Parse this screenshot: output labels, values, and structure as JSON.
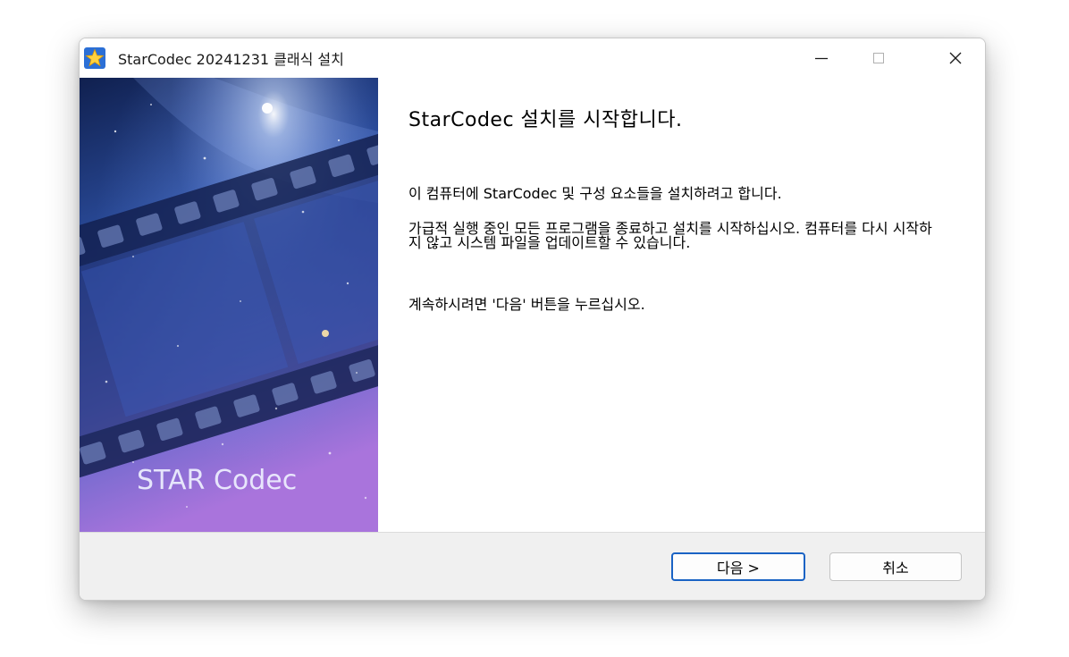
{
  "window": {
    "title": "StarCodec 20241231 클래식 설치",
    "minimize_glyph": "—",
    "maximize_glyph": "□",
    "close_glyph": "✕"
  },
  "banner": {
    "logo_text": "STAR Codec"
  },
  "content": {
    "heading": "StarCodec 설치를 시작합니다.",
    "paragraph_1": "이 컴퓨터에 StarCodec 및 구성 요소들을 설치하려고 합니다.",
    "paragraph_2": "가급적 실행 중인 모든 프로그램을 종료하고 설치를 시작하십시오. 컴퓨터를 다시 시작하지 않고 시스템 파일을 업데이트할 수 있습니다.",
    "paragraph_3": "계속하시려면 '다음' 버튼을 누르십시오."
  },
  "footer": {
    "next_label": "다음 >",
    "cancel_label": "취소"
  },
  "colors": {
    "accent": "#1a63c4",
    "footer_bg": "#f0f0f0",
    "banner_top": "#12245e",
    "banner_bottom": "#a070d8"
  },
  "icons": {
    "app": "star-icon",
    "minimize": "minimize-icon",
    "maximize": "maximize-icon",
    "close": "close-icon"
  }
}
